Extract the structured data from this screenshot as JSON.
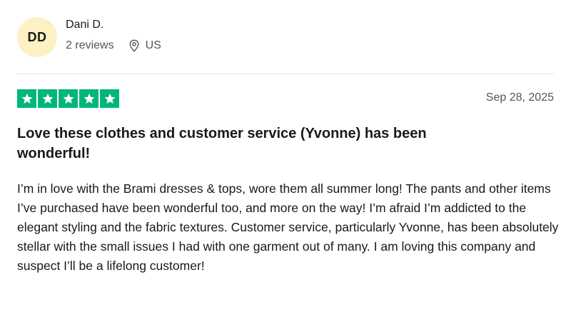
{
  "reviewer": {
    "initials": "DD",
    "name": "Dani D.",
    "reviews_count": "2 reviews",
    "location": "US",
    "avatar_color": "#fdf1c5"
  },
  "review": {
    "rating": 5,
    "rating_max": 5,
    "star_color": "#00b67a",
    "date": "Sep 28, 2025",
    "title": "Love these clothes and customer service (Yvonne) has been wonderful!",
    "body": "I’m in love with the Brami dresses & tops, wore them all summer long! The pants and other items I’ve purchased have been wonderful too, and more on the way! I’m afraid I’m addicted to the elegant styling and the fabric textures. Customer service, particularly Yvonne, has been absolutely stellar with the small issues I had with one garment out of many. I am loving this company and suspect I’ll be a lifelong customer!"
  },
  "icons": {
    "location": "location-pin-icon",
    "star": "star-icon"
  }
}
